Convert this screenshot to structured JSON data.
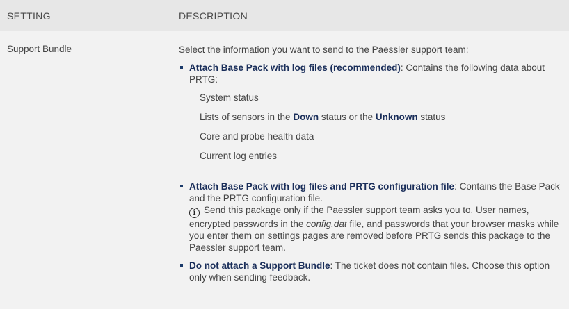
{
  "header": {
    "setting": "SETTING",
    "description": "DESCRIPTION"
  },
  "row": {
    "setting": "Support Bundle",
    "intro": "Select the information you want to send to the Paessler support team:",
    "options": [
      {
        "title": "Attach Base Pack with log files (recommended)",
        "text": ": Contains the following data about PRTG:",
        "items": {
          "system_status": "System status",
          "lists_prefix": "Lists of sensors in the ",
          "lists_down": "Down",
          "lists_mid": " status or the ",
          "lists_unknown": "Unknown",
          "lists_suffix": " status",
          "core": "Core and probe health data",
          "log": "Current log entries"
        }
      },
      {
        "title": "Attach Base Pack with log files and PRTG configuration file",
        "text": ": Contains the Base Pack and the PRTG configuration file.",
        "note_a": "Send this package only if the Paessler support team asks you to. User names, encrypted passwords in the ",
        "note_file": "config.dat",
        "note_b": " file, and passwords that your browser masks while you enter them on settings pages are removed before PRTG sends this package to the Paessler support team."
      },
      {
        "title": "Do not attach a Support Bundle",
        "text": ": The ticket does not contain files. Choose this option only when sending feedback."
      }
    ]
  },
  "icons": {
    "info": "info-icon",
    "bullet": "square-bullet"
  },
  "colors": {
    "header_bg": "#e7e7e7",
    "row_bg": "#f2f2f2",
    "accent": "#1a2e5a"
  }
}
